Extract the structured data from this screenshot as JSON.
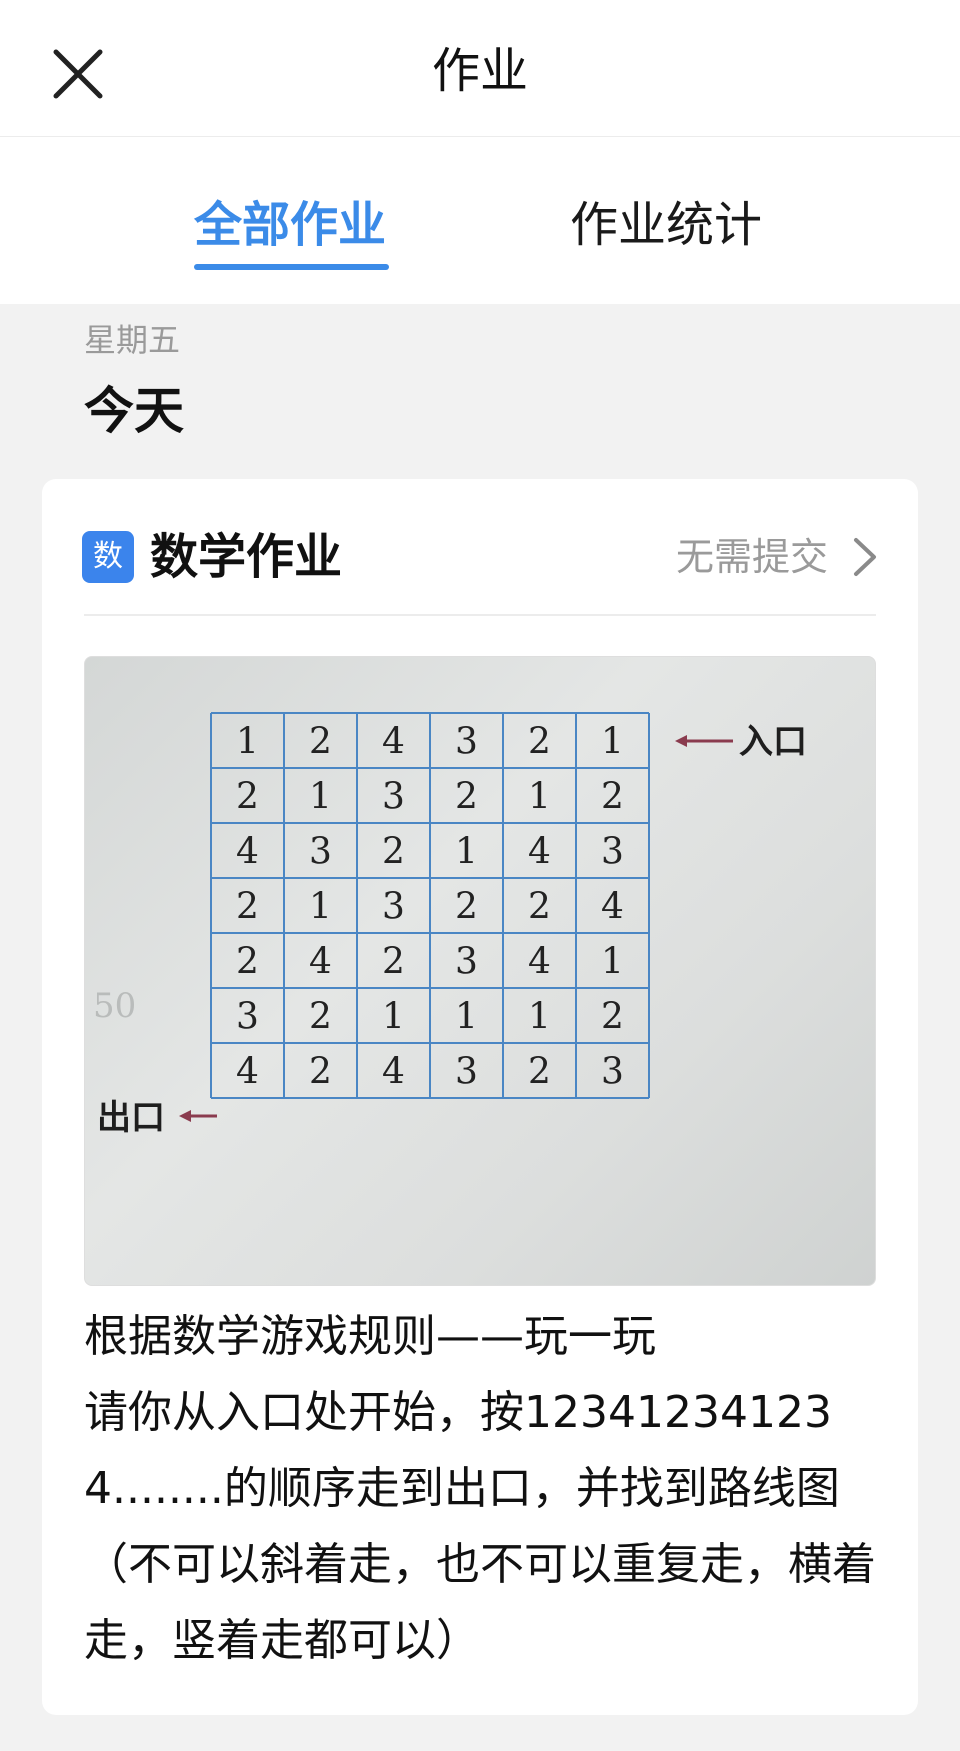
{
  "header": {
    "title": "作业",
    "close_icon": "close-icon"
  },
  "tabs": [
    {
      "label": "全部作业",
      "active": true
    },
    {
      "label": "作业统计",
      "active": false
    }
  ],
  "colors": {
    "accent": "#3b8be8",
    "badge": "#3b84ec",
    "muted": "#9a9a9a",
    "background": "#f2f2f2"
  },
  "date_section": {
    "weekday": "星期五",
    "day_label": "今天"
  },
  "homework_card": {
    "subject_badge": "数",
    "title": "数学作业",
    "submit_status": "无需提交",
    "chevron_icon": "chevron-right-icon",
    "photo": {
      "entry_label": "入口",
      "exit_label": "出口",
      "grid": [
        [
          "1",
          "2",
          "4",
          "3",
          "2",
          "1"
        ],
        [
          "2",
          "1",
          "3",
          "2",
          "1",
          "2"
        ],
        [
          "4",
          "3",
          "2",
          "1",
          "4",
          "3"
        ],
        [
          "2",
          "1",
          "3",
          "2",
          "2",
          "4"
        ],
        [
          "2",
          "4",
          "2",
          "3",
          "4",
          "1"
        ],
        [
          "3",
          "2",
          "1",
          "1",
          "1",
          "2"
        ],
        [
          "4",
          "2",
          "4",
          "3",
          "2",
          "3"
        ]
      ]
    },
    "description": "根据数学游戏规则——玩一玩\n请你从入口处开始，按123412341234........的顺序走到出口，并找到路线图（不可以斜着走，也不可以重复走，横着走，竖着走都可以）"
  }
}
